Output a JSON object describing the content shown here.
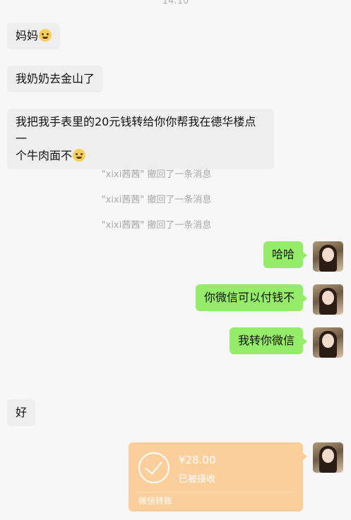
{
  "chat": {
    "time": "14:10",
    "messages": {
      "m1": "妈妈",
      "m2": "我奶奶去金山了",
      "m3_line1": "我把我手表里的20元钱转给你你帮我在德华楼点一",
      "m3_line2": "个牛肉面不",
      "recall1": "\"xixi茜茜\" 撤回了一条消息",
      "recall2": "\"xixi茜茜\" 撤回了一条消息",
      "recall3": "\"xixi茜茜\" 撤回了一条消息",
      "r1": "哈哈",
      "r2": "你微信可以付钱不",
      "r3": "我转你微信",
      "m4": "好"
    },
    "transfer": {
      "amount": "¥28.00",
      "status": "已被接收",
      "label": "微信转账"
    }
  },
  "colors": {
    "background": "#f7f7f7",
    "incoming_bubble": "#eeeeef",
    "outgoing_bubble": "#95ec69",
    "transfer_card": "#fbcf9c"
  },
  "icons": {
    "emoji": "grinning-face-icon",
    "check": "check-circle-icon"
  }
}
